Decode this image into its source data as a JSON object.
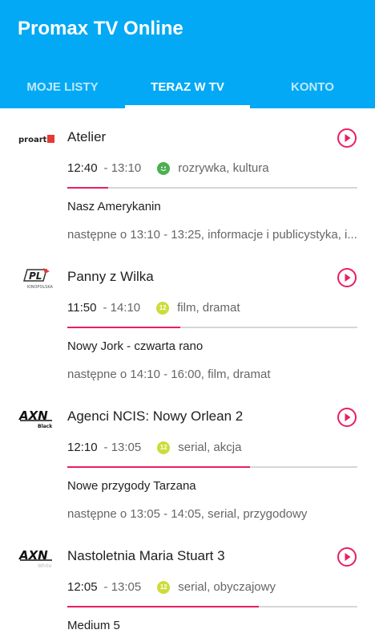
{
  "app": {
    "title": "Promax TV Online"
  },
  "tabs": [
    {
      "label": "MOJE LISTY",
      "active": false
    },
    {
      "label": "TERAZ W TV",
      "active": true
    },
    {
      "label": "KONTO",
      "active": false
    }
  ],
  "colors": {
    "primary": "#03A9F4",
    "accent": "#E91E63",
    "rating_green": "#4CAF50",
    "rating_yellow": "#CDDC39"
  },
  "channels": [
    {
      "logo_icon": "proart-logo",
      "logo_text": "proart",
      "title": "Atelier",
      "start": "12:40",
      "end": "- 13:10",
      "rating_icon": "smiley-rating-icon",
      "genre": "rozrywka, kultura",
      "progress": 0.14,
      "next_title": "Nasz Amerykanin",
      "next_info": "następne o 13:10 - 13:25, informacje i publicystyka, i..."
    },
    {
      "logo_icon": "kino-polska-logo",
      "logo_text": "PL",
      "logo_subtext": "KINO POLSKA",
      "title": "Panny z Wilka",
      "start": "11:50",
      "end": "- 14:10",
      "rating_icon": "rating-12-icon",
      "rating_text": "12",
      "genre": "film, dramat",
      "progress": 0.39,
      "next_title": "Nowy Jork - czwarta rano",
      "next_info": "następne o 14:10 - 16:00, film, dramat"
    },
    {
      "logo_icon": "axn-black-logo",
      "logo_text": "AXN",
      "logo_subtext": "Black",
      "title": "Agenci NCIS: Nowy Orlean 2",
      "start": "12:10",
      "end": "- 13:05",
      "rating_icon": "rating-12-icon",
      "rating_text": "12",
      "genre": "serial, akcja",
      "progress": 0.63,
      "next_title": "Nowe przygody Tarzana",
      "next_info": "następne o 13:05 - 14:05, serial, przygodowy"
    },
    {
      "logo_icon": "axn-white-logo",
      "logo_text": "AXN",
      "logo_subtext": "White",
      "title": "Nastoletnia Maria Stuart 3",
      "start": "12:05",
      "end": "- 13:05",
      "rating_icon": "rating-12-icon",
      "rating_text": "12",
      "genre": "serial, obyczajowy",
      "progress": 0.66,
      "next_title": "Medium 5",
      "next_info": ""
    }
  ]
}
